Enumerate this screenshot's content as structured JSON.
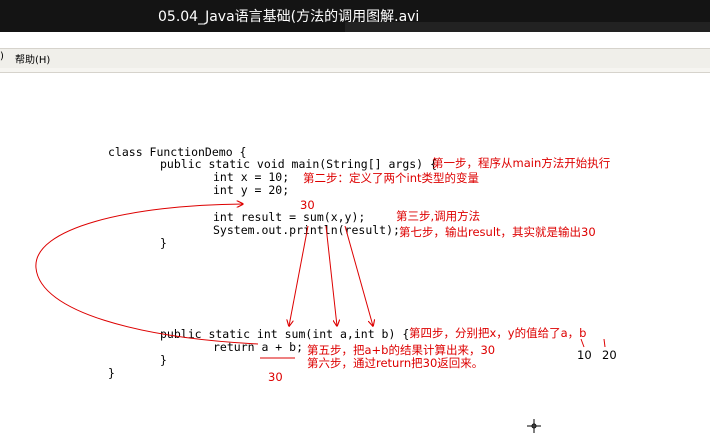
{
  "window": {
    "title": "05.04_Java语言基础(方法的调用图解.avi"
  },
  "menu": {
    "left_fragment": ")",
    "help": "帮助(H)"
  },
  "code": {
    "lines": [
      "class FunctionDemo {",
      "public static void main(String[] args) {",
      "int x = 10;",
      "int y = 20;",
      "int result = sum(x,y);",
      "System.out.println(result);",
      "}",
      "public static int sum(int a,int b) {",
      "return a + b;",
      "}",
      "}"
    ]
  },
  "annotations": {
    "step1": "第一步，程序从main方法开始执行",
    "step2": "第二步：定义了两个int类型的变量",
    "step3": "第三步,调用方法",
    "step7": "第七步，输出result，其实就是输出30",
    "step4": "第四步，分别把x，y的值给了a，b",
    "step5": "第五步，把a+b的结果计算出来，30",
    "step6": "第六步，通过return把30返回来。",
    "result_value_top": "30",
    "result_value_bottom": "30",
    "a_value": "10",
    "b_value": "20"
  },
  "colors": {
    "annotation": "#dd0000",
    "titlebar": "#141414",
    "menubar": "#f0efea"
  }
}
